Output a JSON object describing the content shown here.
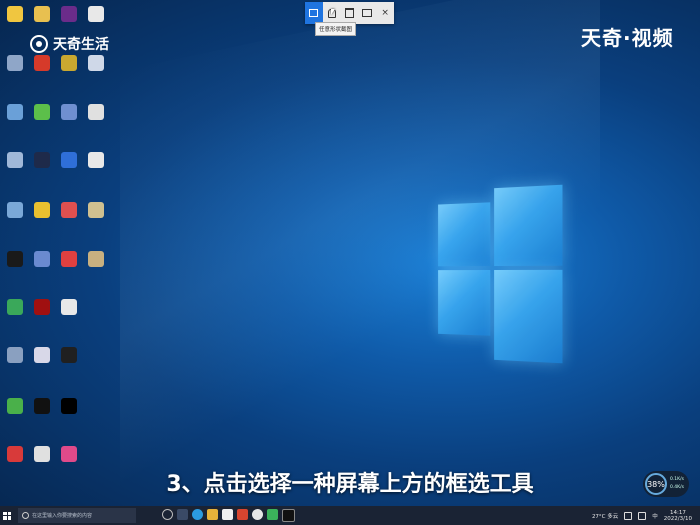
{
  "watermark": {
    "left_text": "天奇生活",
    "right_text": "天奇·视频"
  },
  "snip_toolbar": {
    "tooltip": "任意形状截图",
    "close_label": "×"
  },
  "subtitle": "3、点击选择一种屏幕上方的框选工具",
  "meter": {
    "value": "38",
    "value_unit": "%",
    "up_rate": "0.1K/s",
    "down_rate": "0.4K/s"
  },
  "taskbar": {
    "search_placeholder": "在这里输入你要搜索的内容",
    "weather": "27°C 多云",
    "time": "14:17",
    "date": "2022/3/10",
    "lang": "中"
  },
  "colors": {
    "accent": "#1f74e0",
    "taskbar": "#1a2334"
  }
}
